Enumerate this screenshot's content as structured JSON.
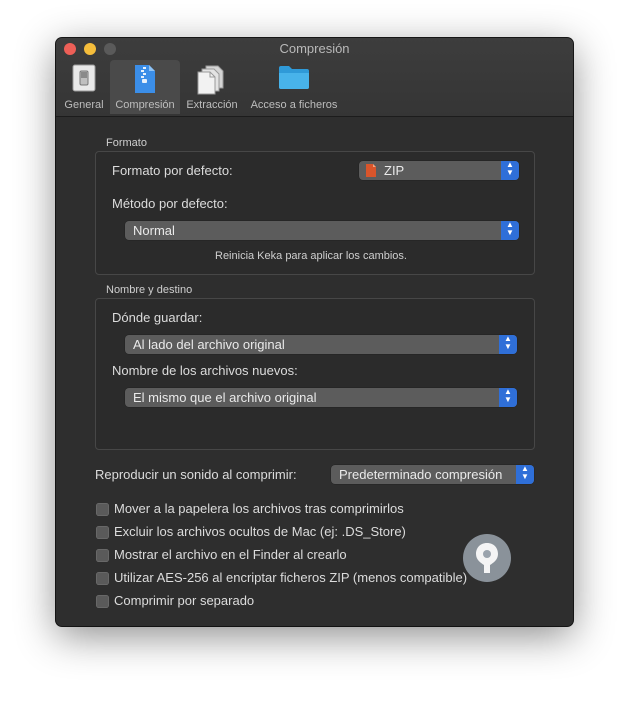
{
  "window": {
    "title": "Compresión"
  },
  "toolbar": {
    "tabs": [
      {
        "label": "General"
      },
      {
        "label": "Compresión"
      },
      {
        "label": "Extracción"
      },
      {
        "label": "Acceso a ficheros"
      }
    ]
  },
  "formato": {
    "section_title": "Formato",
    "default_format_label": "Formato por defecto:",
    "default_format_value": "ZIP",
    "default_method_label": "Método por defecto:",
    "default_method_value": "Normal",
    "restart_note": "Reinicia Keka para aplicar los cambios."
  },
  "destino": {
    "section_title": "Nombre y destino",
    "save_where_label": "Dónde guardar:",
    "save_where_value": "Al lado del archivo original",
    "new_names_label": "Nombre de los archivos nuevos:",
    "new_names_value": "El mismo que el archivo original"
  },
  "sound": {
    "label": "Reproducir un sonido al comprimir:",
    "value": "Predeterminado compresión"
  },
  "options": [
    {
      "label": "Mover a la papelera los archivos tras comprimirlos",
      "checked": false
    },
    {
      "label": "Excluir los archivos ocultos de Mac (ej: .DS_Store)",
      "checked": false
    },
    {
      "label": "Mostrar el archivo en el Finder al crearlo",
      "checked": false
    },
    {
      "label": "Utilizar AES-256 al encriptar ficheros ZIP (menos compatible)",
      "checked": false
    },
    {
      "label": "Comprimir por separado",
      "checked": false
    }
  ],
  "colors": {
    "accent": "#2f6fd8",
    "window_bg": "#2e2e2e"
  }
}
